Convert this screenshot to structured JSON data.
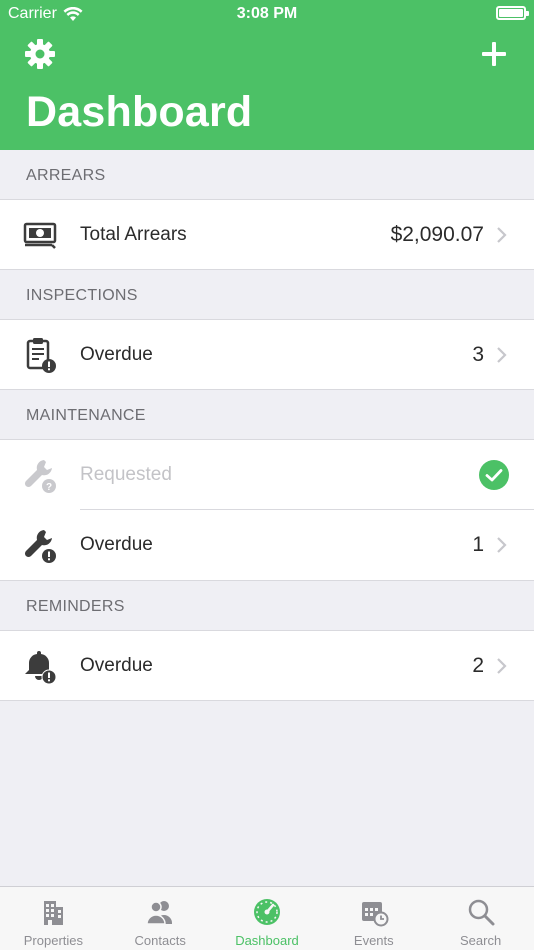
{
  "status": {
    "carrier": "Carrier",
    "time": "3:08 PM",
    "battery_level": 1.0
  },
  "header": {
    "title": "Dashboard",
    "left_icon": "gear-icon",
    "right_icon": "plus-icon",
    "color": "#4cc166"
  },
  "sections": {
    "arrears": {
      "title": "ARREARS",
      "rows": [
        {
          "icon": "money-icon",
          "label": "Total Arrears",
          "value": "$2,090.07"
        }
      ]
    },
    "inspections": {
      "title": "INSPECTIONS",
      "rows": [
        {
          "icon": "clipboard-alert-icon",
          "label": "Overdue",
          "value": "3"
        }
      ]
    },
    "maintenance": {
      "title": "MAINTENANCE",
      "rows": [
        {
          "icon": "wrench-question-icon",
          "label": "Requested",
          "value": "",
          "status": "complete"
        },
        {
          "icon": "wrench-alert-icon",
          "label": "Overdue",
          "value": "1"
        }
      ]
    },
    "reminders": {
      "title": "REMINDERS",
      "rows": [
        {
          "icon": "bell-alert-icon",
          "label": "Overdue",
          "value": "2"
        }
      ]
    }
  },
  "tabs": [
    {
      "label": "Properties",
      "icon": "building-icon",
      "active": false
    },
    {
      "label": "Contacts",
      "icon": "contacts-icon",
      "active": false
    },
    {
      "label": "Dashboard",
      "icon": "dashboard-gauge-icon",
      "active": true
    },
    {
      "label": "Events",
      "icon": "calendar-clock-icon",
      "active": false
    },
    {
      "label": "Search",
      "icon": "search-icon",
      "active": false
    }
  ],
  "colors": {
    "accent": "#4cc166",
    "background": "#efeff4",
    "inactive_tab": "#8e8e93"
  }
}
